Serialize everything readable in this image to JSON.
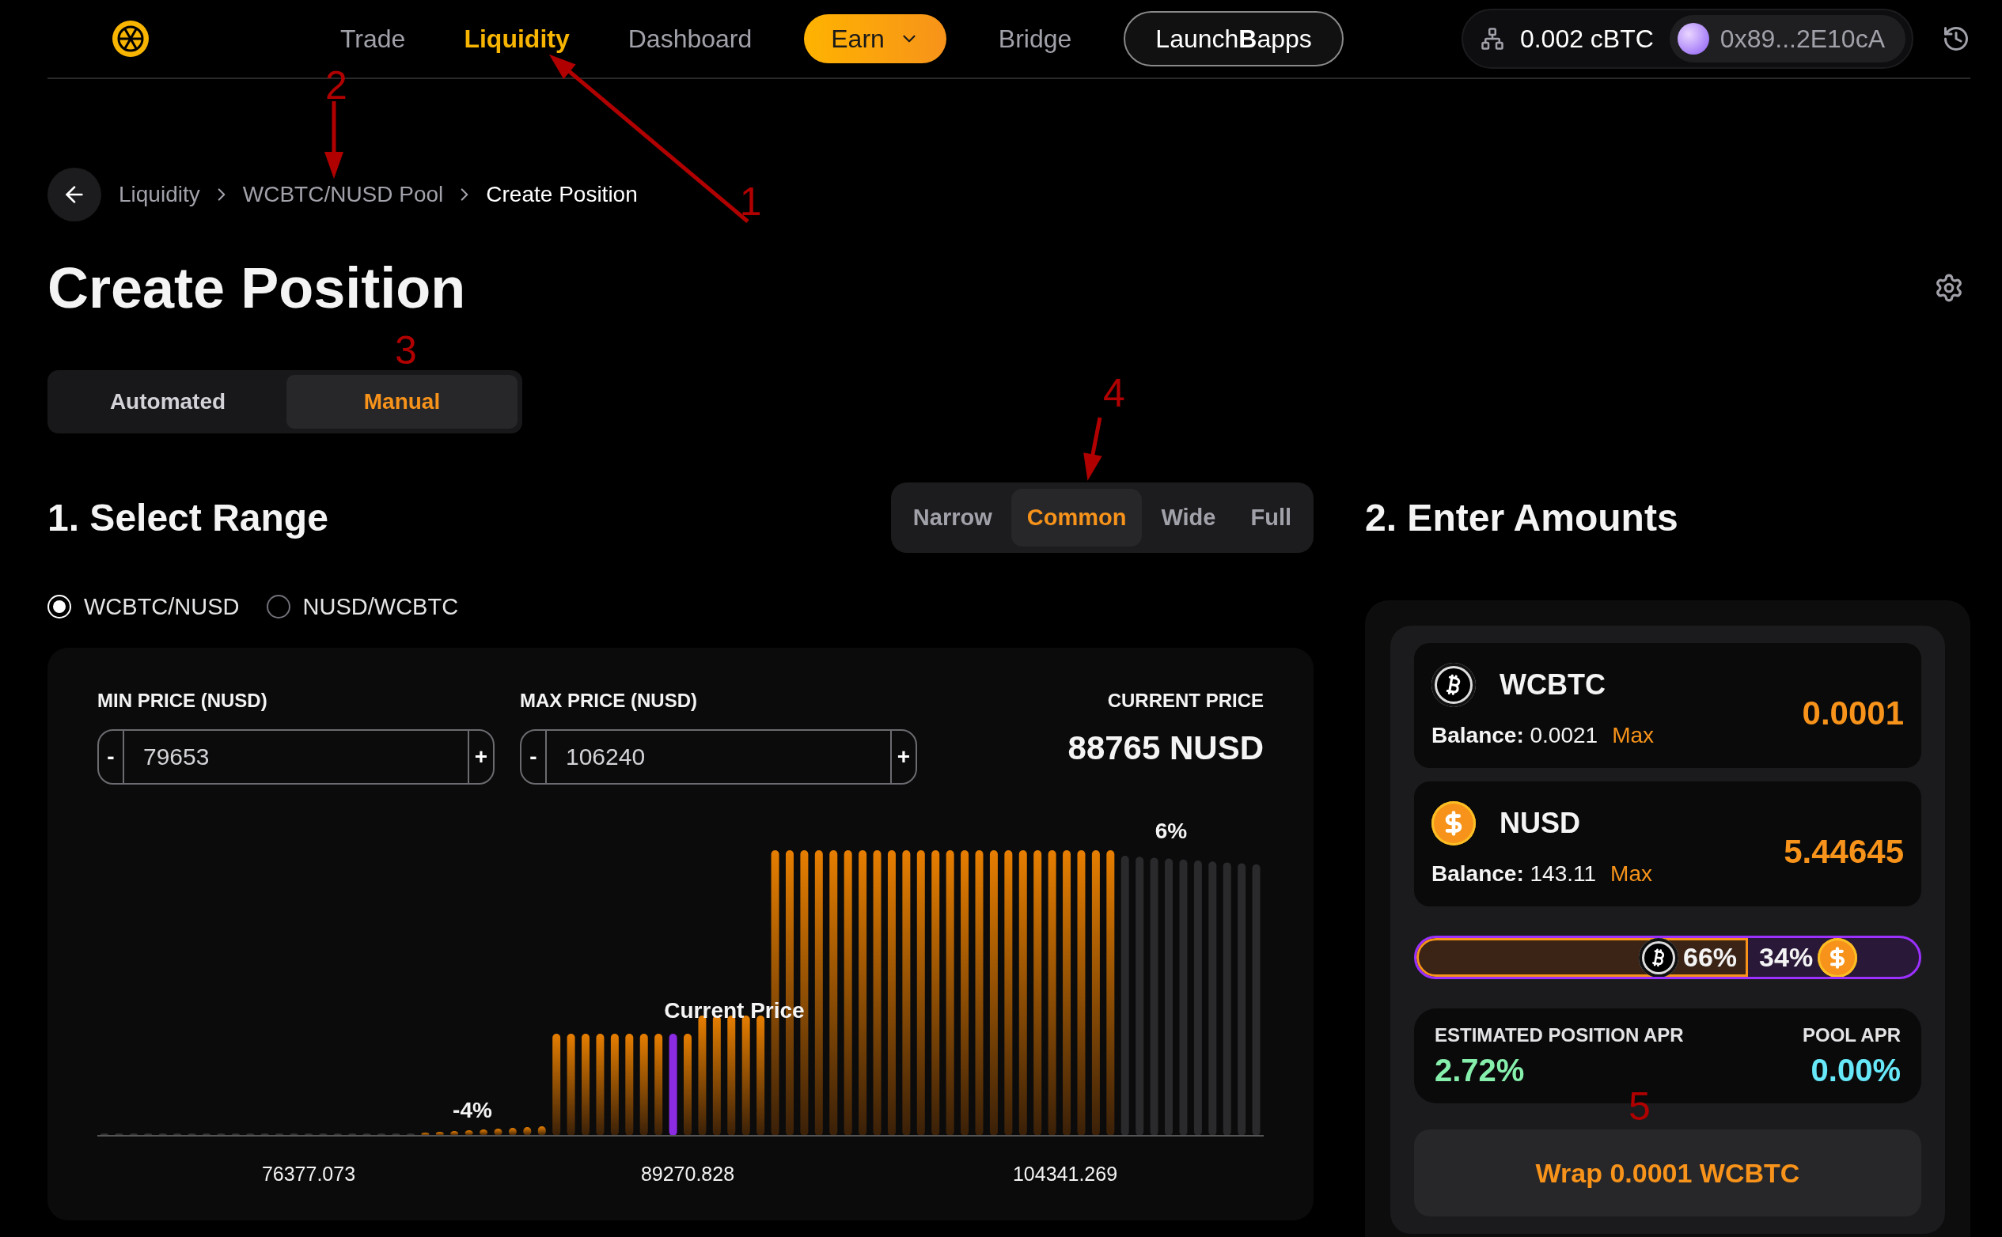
{
  "nav": {
    "items": [
      {
        "label": "Trade",
        "kind": "link",
        "selected": false
      },
      {
        "label": "Liquidity",
        "kind": "link",
        "selected": true
      },
      {
        "label": "Dashboard",
        "kind": "link",
        "selected": false
      },
      {
        "label": "Earn",
        "kind": "dropdown",
        "selected": false
      },
      {
        "label": "Bridge",
        "kind": "link",
        "selected": false
      },
      {
        "label": "Launch**B**apps",
        "kind": "outline",
        "selected": false
      }
    ],
    "wallet": {
      "balance": "0.002 cBTC",
      "address": "0x89...2E10cA"
    }
  },
  "breadcrumb": [
    "Liquidity",
    "WCBTC/NUSD Pool",
    "Create Position"
  ],
  "title": "Create Position",
  "mode_tabs": [
    {
      "label": "Automated",
      "selected": false
    },
    {
      "label": "Manual",
      "selected": true
    }
  ],
  "range": {
    "title": "1. Select Range",
    "presets": [
      {
        "label": "Narrow",
        "selected": false
      },
      {
        "label": "Common",
        "selected": true
      },
      {
        "label": "Wide",
        "selected": false
      },
      {
        "label": "Full",
        "selected": false
      }
    ],
    "pair_options": [
      {
        "label": "WCBTC/NUSD",
        "selected": true
      },
      {
        "label": "NUSD/WCBTC",
        "selected": false
      }
    ],
    "min_price": {
      "label": "MIN PRICE (NUSD)",
      "value": "79653",
      "minus": "-",
      "plus": "+"
    },
    "max_price": {
      "label": "MAX PRICE (NUSD)",
      "value": "106240",
      "minus": "-",
      "plus": "+"
    },
    "current_price": {
      "label": "CURRENT PRICE",
      "value": "88765 NUSD"
    },
    "chart": {
      "markers": [
        "-4%",
        "Current Price",
        "6%"
      ],
      "axis_labels": [
        "76377.073",
        "89270.828",
        "104341.269"
      ]
    }
  },
  "amounts": {
    "title": "2. Enter Amounts",
    "tokens": [
      {
        "symbol": "WCBTC",
        "kind": "btc",
        "balance_label": "Balance:",
        "balance": "0.0021",
        "max": "Max",
        "amount": "0.0001"
      },
      {
        "symbol": "NUSD",
        "kind": "usd",
        "balance_label": "Balance:",
        "balance": "143.11",
        "max": "Max",
        "amount": "5.44645"
      }
    ],
    "ratio": {
      "level": 0.66,
      "left_label": "66%",
      "right_label": "34%"
    },
    "apr": [
      {
        "label": "ESTIMATED POSITION APR",
        "value": "2.72%",
        "color": "#86efac"
      },
      {
        "label": "POOL APR",
        "value": "0.00%",
        "color": "#67e8f9"
      }
    ],
    "action": "Wrap 0.0001 WCBTC"
  },
  "annotations": [
    {
      "label": "1",
      "kind": "arrow"
    },
    {
      "label": "2",
      "kind": "arrow"
    },
    {
      "label": "3",
      "kind": "label"
    },
    {
      "label": "4",
      "kind": "arrow"
    },
    {
      "label": "5",
      "kind": "label"
    }
  ]
}
